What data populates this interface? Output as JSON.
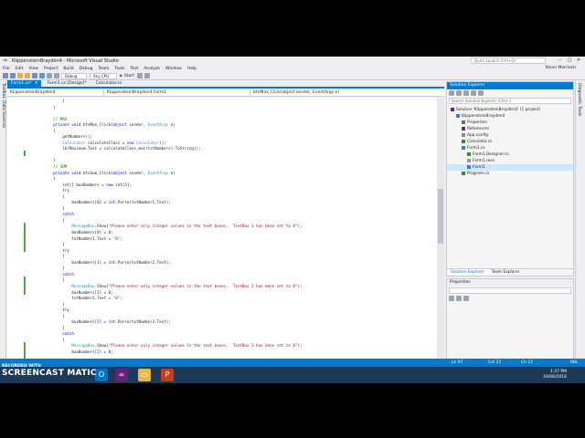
{
  "window": {
    "title": "KlippensteinBrayden4 - Microsoft Visual Studio",
    "quick_launch": "Quick Launch (Ctrl+Q)",
    "user": "Kevin Morrison"
  },
  "menu": [
    "File",
    "Edit",
    "View",
    "Project",
    "Build",
    "Debug",
    "Team",
    "Tools",
    "Test",
    "Analyze",
    "Window",
    "Help"
  ],
  "toolbar": {
    "config": "Debug",
    "platform": "Any CPU",
    "start_label": "Start"
  },
  "left_tabs": [
    "Toolbox",
    "Data Sources"
  ],
  "right_tabs": [
    "Diagnostic Tools"
  ],
  "doc_tabs": [
    {
      "label": "Form1.cs*",
      "state": "active"
    },
    {
      "label": "Form1.cs [Design]*",
      "state": "normal"
    },
    {
      "label": "Calculator.cs",
      "state": "normal"
    }
  ],
  "navbar": {
    "project": "KlippensteinBrayden4",
    "class": "KlippensteinBrayden4.Form1",
    "member": "btnMax_Click(object sender, EventArgs e)"
  },
  "code_lines": [
    [
      {
        "t": "            }",
        "c": ""
      }
    ],
    [
      {
        "t": "        }",
        "c": ""
      }
    ],
    [
      {
        "t": "",
        "c": ""
      }
    ],
    [
      {
        "t": "        // MAX",
        "c": "cm"
      }
    ],
    [
      {
        "t": "        ",
        "c": ""
      },
      {
        "t": "private void",
        "c": "kw"
      },
      {
        "t": " btnMax_Click(",
        "c": ""
      },
      {
        "t": "object",
        "c": "kw"
      },
      {
        "t": " sender, ",
        "c": ""
      },
      {
        "t": "EventArgs",
        "c": "ty"
      },
      {
        "t": " e)",
        "c": ""
      }
    ],
    [
      {
        "t": "        {",
        "c": ""
      }
    ],
    [
      {
        "t": "            getNumbers();",
        "c": ""
      }
    ],
    [
      {
        "t": "            ",
        "c": ""
      },
      {
        "t": "Calculator",
        "c": "ty"
      },
      {
        "t": " calculateClass = ",
        "c": ""
      },
      {
        "t": "new",
        "c": "kw"
      },
      {
        "t": " ",
        "c": ""
      },
      {
        "t": "Calculator",
        "c": "ty"
      },
      {
        "t": "();",
        "c": ""
      }
    ],
    [
      {
        "t": "            lblMaximum.Text = calculateClass.max(txtNumbers).ToString();",
        "c": ""
      }
    ],
    [
      {
        "t": "",
        "c": ""
      }
    ],
    [
      {
        "t": "        }",
        "c": ""
      }
    ],
    [
      {
        "t": "        // SUM",
        "c": "cm"
      }
    ],
    [
      {
        "t": "        ",
        "c": ""
      },
      {
        "t": "private void",
        "c": "kw"
      },
      {
        "t": " btnSum_Click(",
        "c": ""
      },
      {
        "t": "object",
        "c": "kw"
      },
      {
        "t": " sender, ",
        "c": ""
      },
      {
        "t": "EventArgs",
        "c": "ty"
      },
      {
        "t": " e)",
        "c": ""
      }
    ],
    [
      {
        "t": "        {",
        "c": ""
      }
    ],
    [
      {
        "t": "            ",
        "c": ""
      },
      {
        "t": "int",
        "c": "kw"
      },
      {
        "t": "[] boxNumbers = ",
        "c": ""
      },
      {
        "t": "new",
        "c": "kw"
      },
      {
        "t": " ",
        "c": ""
      },
      {
        "t": "int",
        "c": "kw"
      },
      {
        "t": "[3];",
        "c": ""
      }
    ],
    [
      {
        "t": "            ",
        "c": ""
      },
      {
        "t": "try",
        "c": "kw"
      }
    ],
    [
      {
        "t": "            {",
        "c": ""
      }
    ],
    [
      {
        "t": "                boxNumbers[0] = ",
        "c": ""
      },
      {
        "t": "int",
        "c": "kw"
      },
      {
        "t": ".Parse(txtNumber1.Text);",
        "c": ""
      }
    ],
    [
      {
        "t": "            }",
        "c": ""
      }
    ],
    [
      {
        "t": "            ",
        "c": ""
      },
      {
        "t": "catch",
        "c": "kw"
      }
    ],
    [
      {
        "t": "            {",
        "c": ""
      }
    ],
    [
      {
        "t": "                ",
        "c": ""
      },
      {
        "t": "MessageBox",
        "c": "ty"
      },
      {
        "t": ".Show(",
        "c": ""
      },
      {
        "t": "\"Please enter only integer values in the text boxes.  TextBox 1 has been set to 0\"",
        "c": "str"
      },
      {
        "t": ");",
        "c": ""
      }
    ],
    [
      {
        "t": "                boxNumbers[0] = 0;",
        "c": ""
      }
    ],
    [
      {
        "t": "                txtNumber1.Text = ",
        "c": ""
      },
      {
        "t": "\"0\"",
        "c": "str"
      },
      {
        "t": ";",
        "c": ""
      }
    ],
    [
      {
        "t": "            }",
        "c": ""
      }
    ],
    [
      {
        "t": "            ",
        "c": ""
      },
      {
        "t": "try",
        "c": "kw"
      }
    ],
    [
      {
        "t": "            {",
        "c": ""
      }
    ],
    [
      {
        "t": "                boxNumbers[1] = ",
        "c": ""
      },
      {
        "t": "int",
        "c": "kw"
      },
      {
        "t": ".Parse(txtNumber2.Text);",
        "c": ""
      }
    ],
    [
      {
        "t": "            }",
        "c": ""
      }
    ],
    [
      {
        "t": "            ",
        "c": ""
      },
      {
        "t": "catch",
        "c": "kw"
      }
    ],
    [
      {
        "t": "            {",
        "c": ""
      }
    ],
    [
      {
        "t": "                ",
        "c": ""
      },
      {
        "t": "MessageBox",
        "c": "ty"
      },
      {
        "t": ".Show(",
        "c": ""
      },
      {
        "t": "\"Please enter only integer values in the text boxes.  TextBox 2 has been set to 0\"",
        "c": "str"
      },
      {
        "t": ");",
        "c": ""
      }
    ],
    [
      {
        "t": "                boxNumbers[1] = 0;",
        "c": ""
      }
    ],
    [
      {
        "t": "                txtNumber2.Text = ",
        "c": ""
      },
      {
        "t": "\"0\"",
        "c": "str"
      },
      {
        "t": ";",
        "c": ""
      }
    ],
    [
      {
        "t": "            }",
        "c": ""
      }
    ],
    [
      {
        "t": "            ",
        "c": ""
      },
      {
        "t": "try",
        "c": "kw"
      }
    ],
    [
      {
        "t": "            {",
        "c": ""
      }
    ],
    [
      {
        "t": "                boxNumbers[2] = ",
        "c": ""
      },
      {
        "t": "int",
        "c": "kw"
      },
      {
        "t": ".Parse(txtNumber3.Text);",
        "c": ""
      }
    ],
    [
      {
        "t": "            }",
        "c": ""
      }
    ],
    [
      {
        "t": "            ",
        "c": ""
      },
      {
        "t": "catch",
        "c": "kw"
      }
    ],
    [
      {
        "t": "            {",
        "c": ""
      }
    ],
    [
      {
        "t": "                ",
        "c": ""
      },
      {
        "t": "MessageBox",
        "c": "ty"
      },
      {
        "t": ".Show(",
        "c": ""
      },
      {
        "t": "\"Please enter only integer values in the text boxes.  TextBox 3 has been set to 0\"",
        "c": "str"
      },
      {
        "t": ");",
        "c": ""
      }
    ],
    [
      {
        "t": "                boxNumbers[2] = 0;",
        "c": ""
      }
    ]
  ],
  "zoom": "100 %",
  "solution_explorer": {
    "title": "Solution Explorer",
    "search_placeholder": "Search Solution Explorer (Ctrl+;)",
    "nodes": [
      {
        "label": "Solution 'KlippensteinBrayden4' (1 project)",
        "indent": 0,
        "icon": "solution",
        "sel": false
      },
      {
        "label": "KlippensteinBrayden4",
        "indent": 1,
        "icon": "project",
        "sel": false
      },
      {
        "label": "Properties",
        "indent": 2,
        "icon": "wrench",
        "sel": false
      },
      {
        "label": "References",
        "indent": 2,
        "icon": "references",
        "sel": false
      },
      {
        "label": "App.config",
        "indent": 2,
        "icon": "config",
        "sel": false
      },
      {
        "label": "Calculator.cs",
        "indent": 2,
        "icon": "cs",
        "sel": false
      },
      {
        "label": "Form1.cs",
        "indent": 2,
        "icon": "form",
        "sel": false
      },
      {
        "label": "Form1.Designer.cs",
        "indent": 3,
        "icon": "cs",
        "sel": false
      },
      {
        "label": "Form1.resx",
        "indent": 3,
        "icon": "resx",
        "sel": false
      },
      {
        "label": "Form1",
        "indent": 3,
        "icon": "form",
        "sel": true
      },
      {
        "label": "Program.cs",
        "indent": 2,
        "icon": "cs",
        "sel": false
      }
    ],
    "tabs": [
      "Solution Explorer",
      "Team Explorer"
    ]
  },
  "properties": {
    "title": "Properties"
  },
  "status": {
    "ln": "Ln 97",
    "col": "Col 21",
    "ch": "Ch 12",
    "mode": "INS"
  },
  "taskbar": {
    "time": "1:37 PM",
    "date": "10/06/2016"
  },
  "watermark": {
    "line1": "RECORDED WITH",
    "line2": "SCREENCAST",
    "line3": "MATIC"
  },
  "colors": {
    "accent": "#007acc",
    "keyword": "#0000ff",
    "type": "#2b91af",
    "string": "#a31515",
    "comment": "#008000"
  }
}
